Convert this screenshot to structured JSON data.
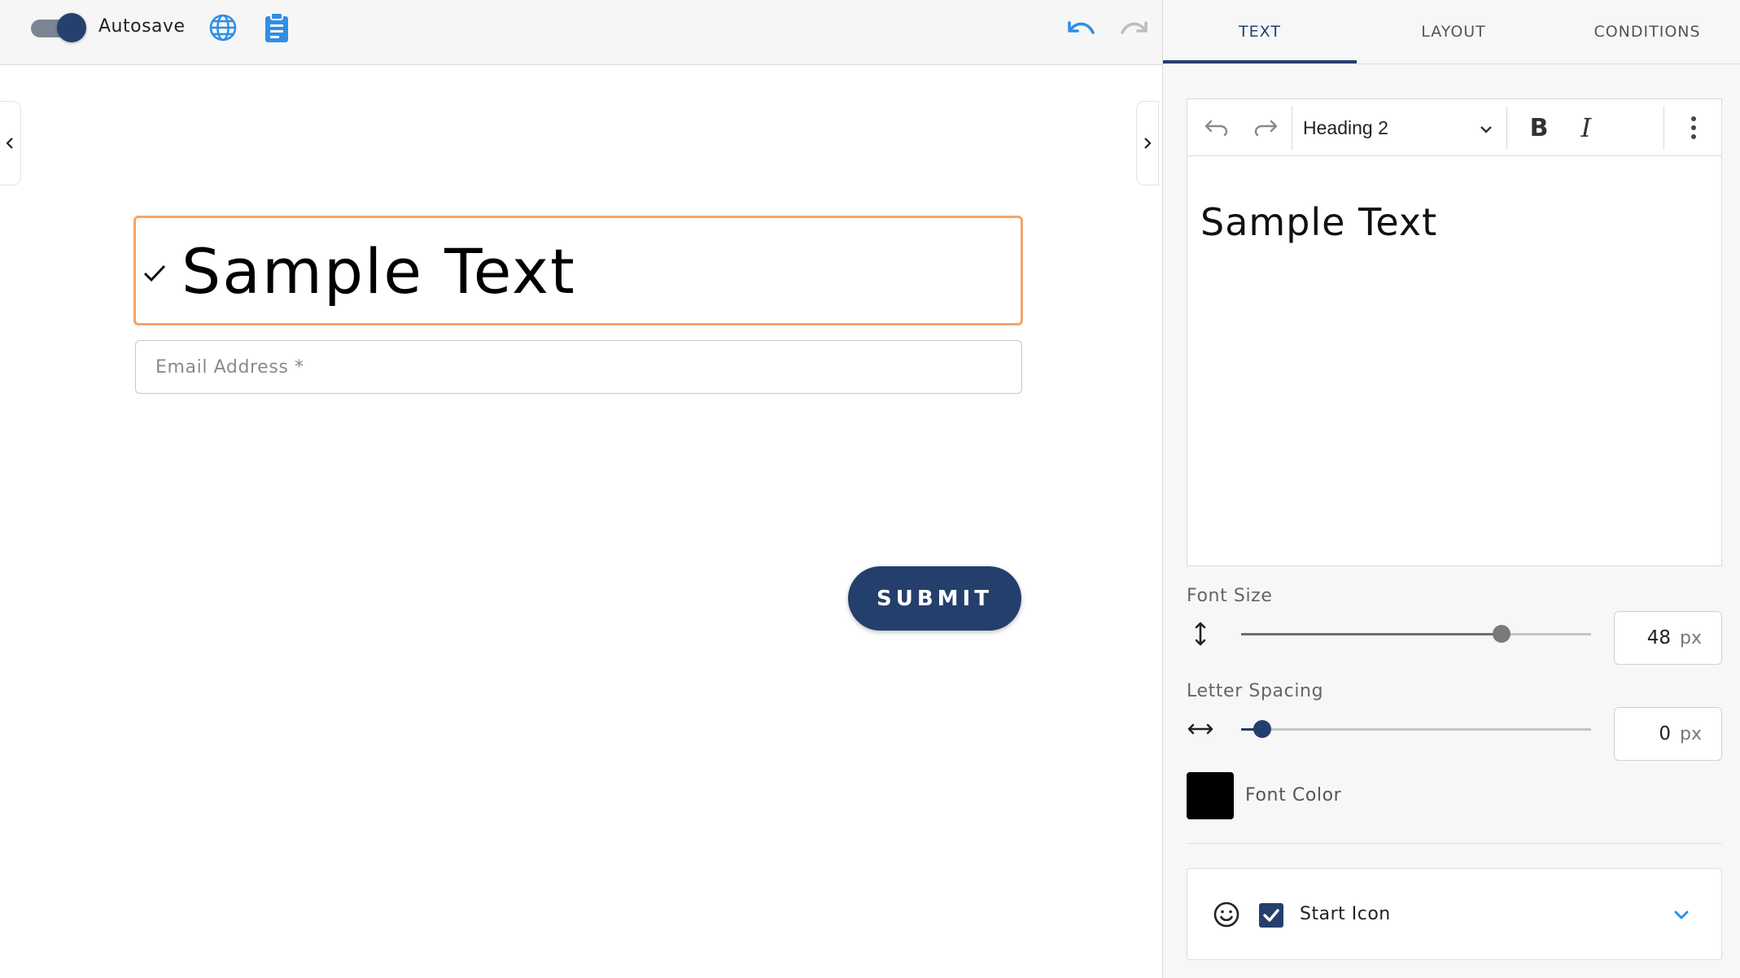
{
  "topbar": {
    "autosave_label": "Autosave",
    "autosave_on": true
  },
  "form": {
    "heading_text": "Sample Text",
    "email_placeholder": "Email Address *",
    "submit_label": "SUBMIT"
  },
  "panel": {
    "tabs": [
      {
        "label": "TEXT",
        "active": true
      },
      {
        "label": "LAYOUT",
        "active": false
      },
      {
        "label": "CONDITIONS",
        "active": false
      }
    ],
    "editor": {
      "style_selected": "Heading 2",
      "bold_label": "B",
      "italic_label": "I",
      "content": "Sample Text"
    },
    "font_size": {
      "label": "Font Size",
      "value": "48",
      "unit": "px",
      "slider_fraction": 0.745
    },
    "letter_spacing": {
      "label": "Letter Spacing",
      "value": "0",
      "unit": "px",
      "slider_fraction": 0.06
    },
    "font_color": {
      "label": "Font Color",
      "value": "#000000"
    },
    "start_icon": {
      "label": "Start Icon",
      "checked": true
    }
  },
  "colors": {
    "primary": "#253f6d",
    "accent_blue": "#2f8fe6",
    "focus_border": "#f2a46c"
  },
  "icons": [
    "globe-icon",
    "clipboard-icon",
    "undo-icon",
    "redo-icon",
    "chevron-left-icon",
    "chevron-right-icon",
    "checkmark-icon",
    "chevron-down-icon",
    "bold-icon",
    "italic-icon",
    "more-vertical-icon",
    "vertical-resize-icon",
    "horizontal-resize-icon",
    "smiley-icon",
    "checkbox-checked-icon"
  ]
}
